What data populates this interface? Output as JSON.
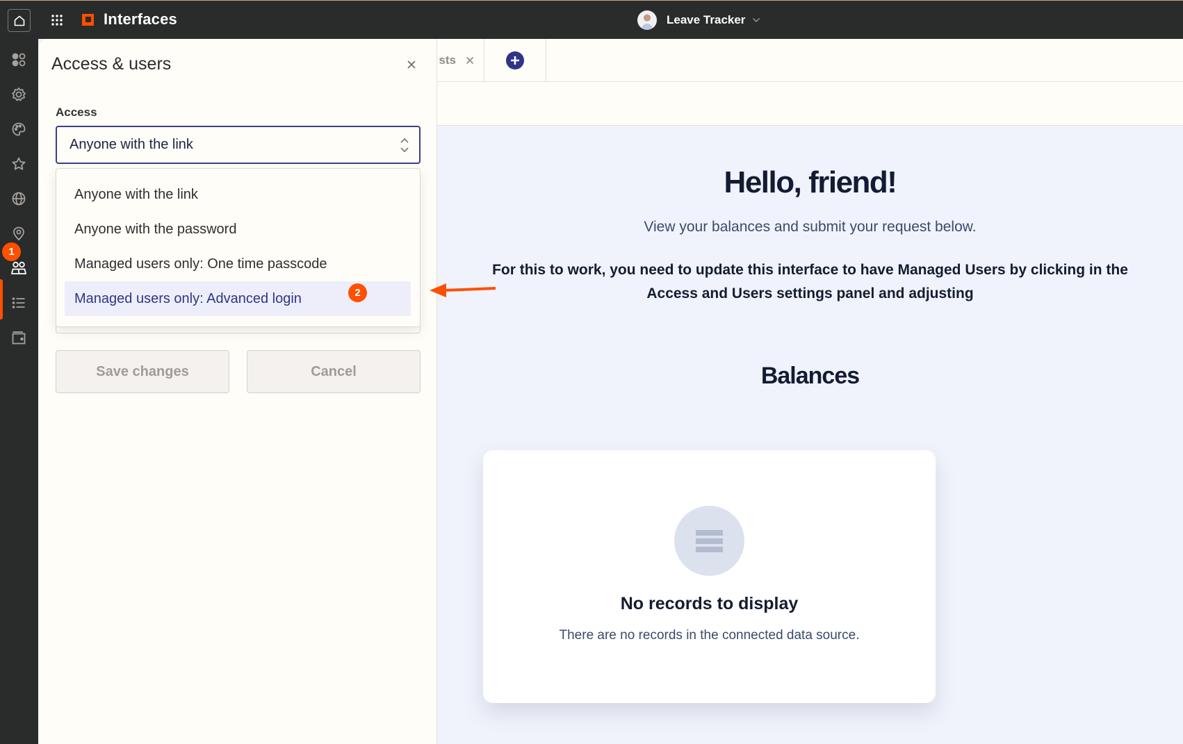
{
  "topbar": {
    "brand_name": "Interfaces",
    "app_name": "Leave Tracker",
    "home_icon": "home-icon",
    "apps_icon": "grid-icon",
    "brand_accent": "#ff4f00"
  },
  "rail": {
    "items": [
      {
        "icon": "components-icon"
      },
      {
        "icon": "settings-icon"
      },
      {
        "icon": "palette-icon"
      },
      {
        "icon": "star-icon"
      },
      {
        "icon": "globe-icon"
      },
      {
        "icon": "location-pin-icon"
      },
      {
        "icon": "users-icon",
        "active": true
      },
      {
        "icon": "list-icon"
      },
      {
        "icon": "wallet-icon"
      }
    ]
  },
  "annotations": {
    "step1": "1",
    "step2": "2",
    "color": "#ff4f00"
  },
  "panel": {
    "title": "Access & users",
    "access_label": "Access",
    "access_value": "Anyone with the link",
    "options": [
      {
        "label": "Anyone with the link"
      },
      {
        "label": "Anyone with the password"
      },
      {
        "label": "Managed users only: One time passcode"
      },
      {
        "label": "Managed users only: Advanced login",
        "highlighted": true
      }
    ],
    "save_label": "Save changes",
    "cancel_label": "Cancel"
  },
  "tabs": {
    "partial_tab_label": "sts"
  },
  "main": {
    "heading": "Hello, friend!",
    "intro": "View your balances and submit your request below.",
    "note": "For this to work, you need to update this interface to have Managed Users by clicking in the Access and Users settings panel and adjusting",
    "balances_heading": "Balances",
    "empty_title": "No records to display",
    "empty_subtitle": "There are no records in the connected data source."
  }
}
